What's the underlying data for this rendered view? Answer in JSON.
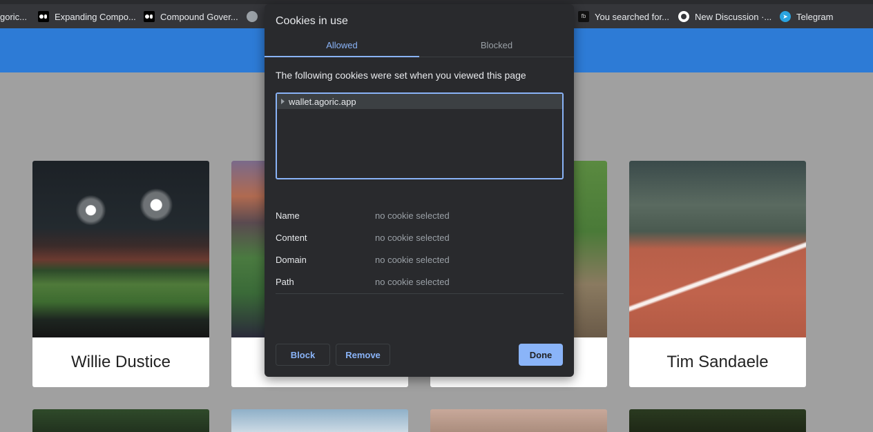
{
  "bookmarks": [
    {
      "label": "goric...",
      "icon": "none"
    },
    {
      "label": "Expanding Compo...",
      "icon": "medium-icon"
    },
    {
      "label": "Compound Gover...",
      "icon": "medium-icon"
    },
    {
      "label": "You searched for...",
      "icon": "site-icon"
    },
    {
      "label": "New Discussion ·...",
      "icon": "github-icon"
    },
    {
      "label": "Telegram",
      "icon": "telegram-icon"
    }
  ],
  "cards": [
    {
      "name": "Willie Dustice"
    },
    {
      "name": ""
    },
    {
      "name": ""
    },
    {
      "name": "Tim Sandaele"
    }
  ],
  "dialog": {
    "title": "Cookies in use",
    "tabs": [
      {
        "label": "Allowed",
        "active": true
      },
      {
        "label": "Blocked",
        "active": false
      }
    ],
    "description": "The following cookies were set when you viewed this page",
    "tree": [
      {
        "label": "wallet.agoric.app",
        "expanded": false
      }
    ],
    "details": [
      {
        "label": "Name",
        "value": "no cookie selected"
      },
      {
        "label": "Content",
        "value": "no cookie selected"
      },
      {
        "label": "Domain",
        "value": "no cookie selected"
      },
      {
        "label": "Path",
        "value": "no cookie selected"
      }
    ],
    "buttons": {
      "block": "Block",
      "remove": "Remove",
      "done": "Done"
    }
  },
  "colors": {
    "header_blue": "#2d7bd6",
    "accent": "#8ab4f8",
    "dialog_bg": "#292a2d"
  }
}
